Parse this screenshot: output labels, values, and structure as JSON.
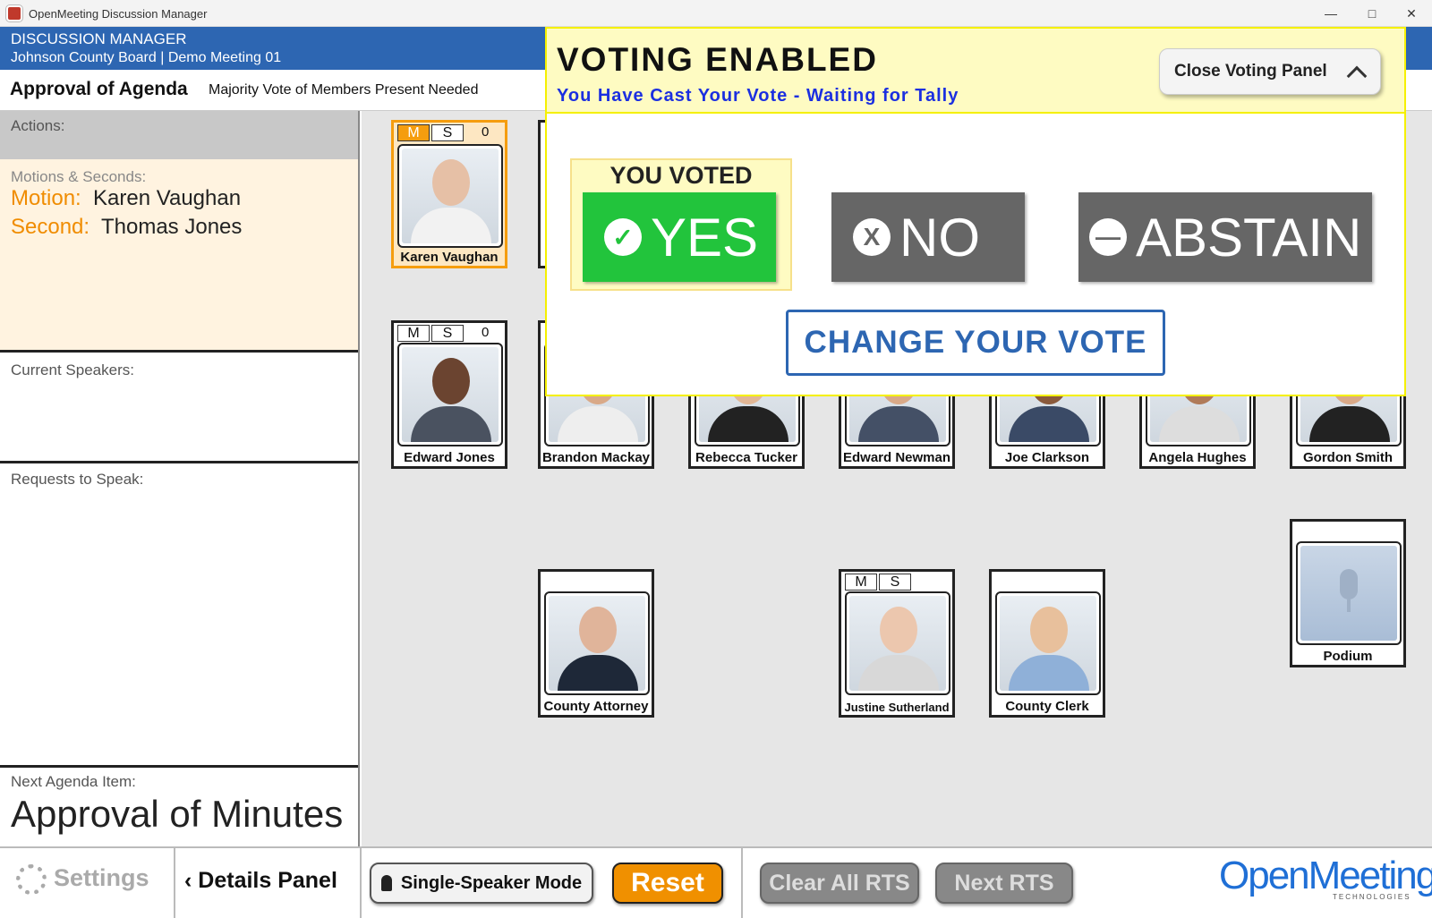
{
  "window": {
    "title": "OpenMeeting Discussion Manager"
  },
  "header": {
    "line1": "DISCUSSION MANAGER",
    "line2": "Johnson County Board | Demo Meeting 01"
  },
  "agenda": {
    "title": "Approval of Agenda",
    "subtitle": "Majority Vote of Members Present Needed"
  },
  "sidebar": {
    "actions_label": "Actions:",
    "motions_label": "Motions & Seconds:",
    "motion_key": "Motion:",
    "motion_value": "Karen Vaughan",
    "second_key": "Second:",
    "second_value": "Thomas Jones",
    "speakers_label": "Current Speakers:",
    "rts_label": "Requests to Speak:",
    "next_label": "Next Agenda Item:",
    "next_value": "Approval of Minutes"
  },
  "members": [
    {
      "name": "Karen Vaughan",
      "m": "M",
      "s": "S",
      "count": "0"
    },
    {
      "name": "Edward Jones",
      "m": "M",
      "s": "S",
      "count": "0"
    },
    {
      "name": "Brandon Mackay"
    },
    {
      "name": "Rebecca Tucker"
    },
    {
      "name": "Edward Newman"
    },
    {
      "name": "Joe Clarkson"
    },
    {
      "name": "Angela Hughes"
    },
    {
      "name": "Gordon Smith"
    },
    {
      "name": "County Attorney"
    },
    {
      "name": "Justine Sutherland",
      "m": "M",
      "s": "S"
    },
    {
      "name": "County Clerk"
    },
    {
      "name": "Podium"
    }
  ],
  "voting": {
    "title": "VOTING ENABLED",
    "status": "You Have Cast Your Vote - Waiting for Tally",
    "close_label": "Close Voting Panel",
    "you_voted": "YOU VOTED",
    "yes": "YES",
    "no": "NO",
    "abstain": "ABSTAIN",
    "change": "CHANGE YOUR VOTE"
  },
  "footer": {
    "settings": "Settings",
    "details": "Details Panel",
    "single": "Single-Speaker Mode",
    "reset": "Reset",
    "clear_rts": "Clear All RTS",
    "next_rts": "Next RTS",
    "logo": "OpenMeeting",
    "logo_sub": "TECHNOLOGIES"
  },
  "colors": {
    "header_blue": "#2d66b2",
    "accent_orange": "#f59d0e",
    "yes_green": "#22c43c",
    "vote_yellow": "#fefbc2"
  }
}
